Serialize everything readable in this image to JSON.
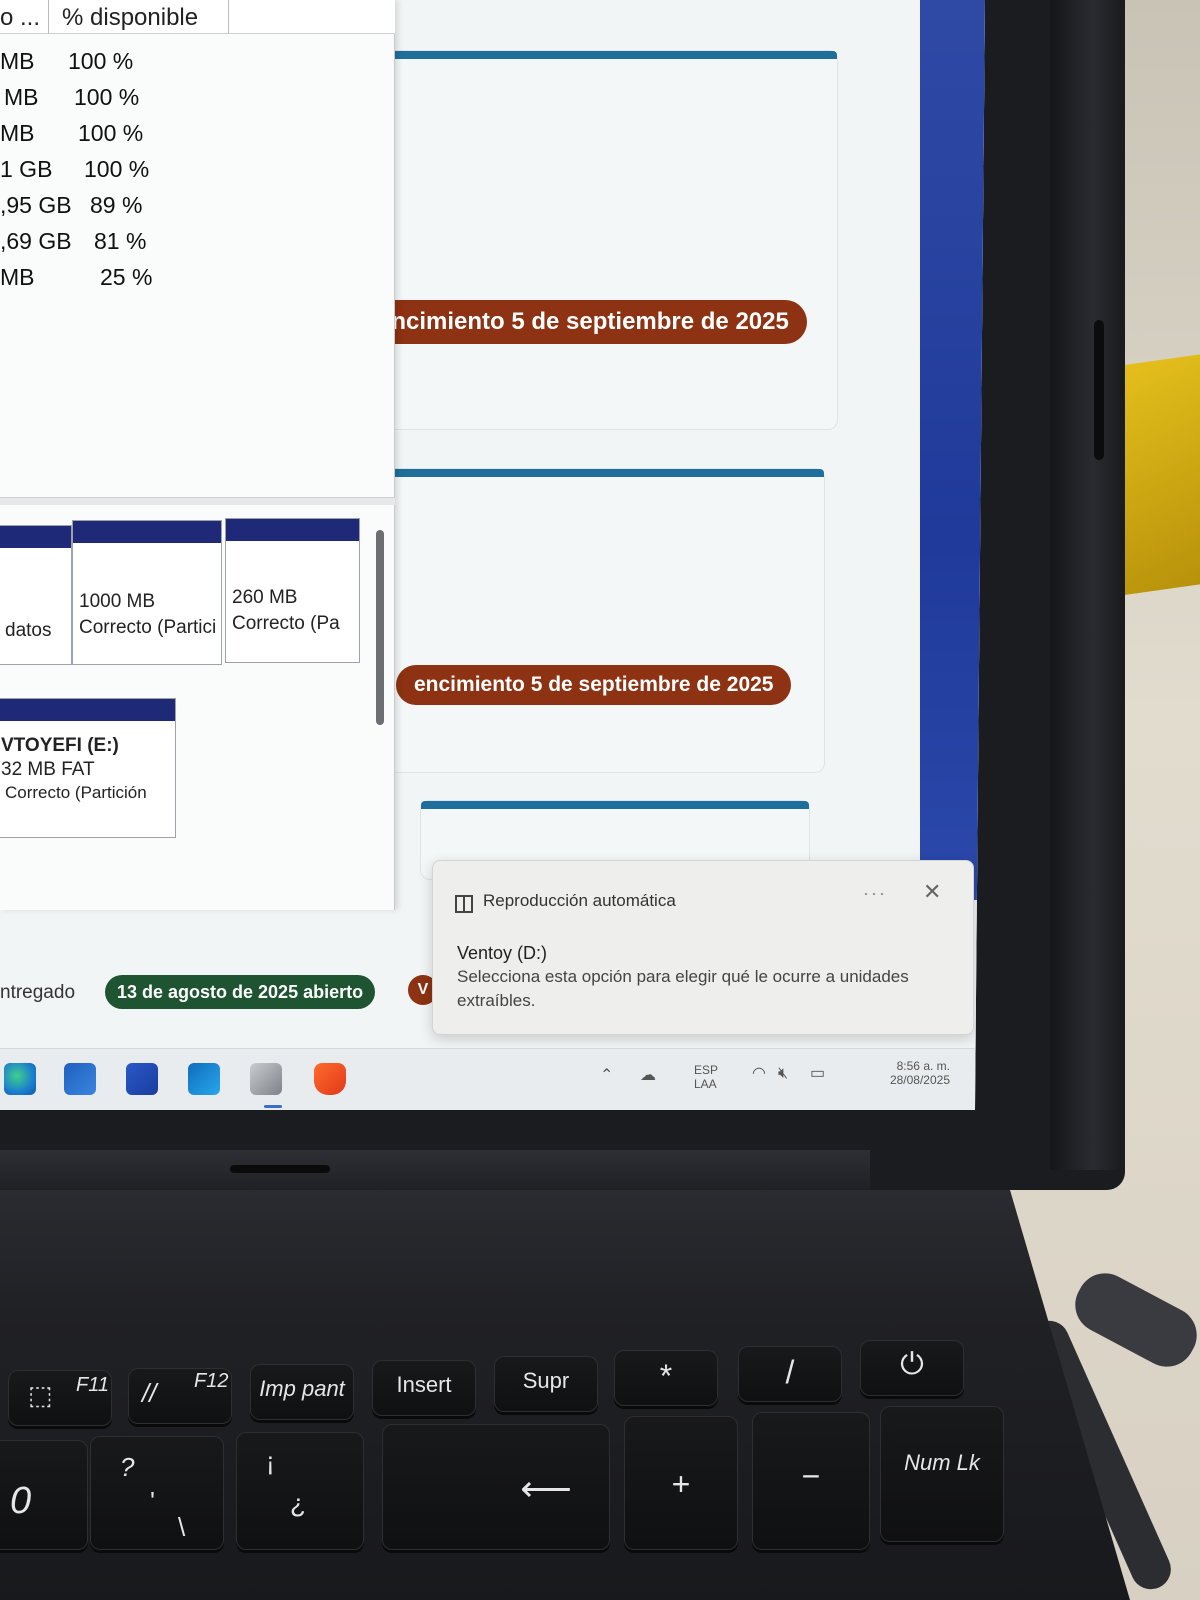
{
  "disk_manager": {
    "column_truncated": "o ...",
    "column_available": "% disponible",
    "volumes": [
      {
        "size": "MB",
        "available": "100 %"
      },
      {
        "size": "MB",
        "available": "100 %"
      },
      {
        "size": "MB",
        "available": "100 %"
      },
      {
        "size": "1 GB",
        "available": "100 %"
      },
      {
        "size": ",95 GB",
        "available": "89 %"
      },
      {
        "size": ",69 GB",
        "available": "81 %"
      },
      {
        "size": "MB",
        "available": "25 %"
      }
    ],
    "partitions": [
      {
        "line1": "",
        "line2": "datos"
      },
      {
        "line1": "1000 MB",
        "line2": "Correcto (Partici"
      },
      {
        "line1": "260 MB",
        "line2": "Correcto (Pa"
      }
    ],
    "ventoy_partition": {
      "name": "VTOYEFI  (E:)",
      "size": "32 MB FAT",
      "status": "Correcto (Partición"
    }
  },
  "web": {
    "due_label": "encimiento 5 de septiembre de 2025",
    "entregado": "ntregado",
    "open_badge": "13 de agosto de 2025 abierto",
    "red_badge_letter": "V"
  },
  "toast": {
    "header": "Reproducción automática",
    "dots": "···",
    "close": "✕",
    "title": "Ventoy (D:)",
    "body": "Selecciona esta opción para elegir qué le ocurre a unidades extraíbles."
  },
  "taskbar": {
    "language": "ESP",
    "layout": "LAA",
    "time": "8:56 a. m.",
    "date": "28/08/2025"
  },
  "keyboard": {
    "f11": "F11",
    "f12": "F12",
    "imp_pant": "Imp pant",
    "insert": "Insert",
    "supr": "Supr",
    "asterisk": "*",
    "slash": "/",
    "power": "⏻",
    "zero": "0",
    "question": "?",
    "apostrophe": "'",
    "backslash": "\\",
    "exclaim": "¡",
    "inv_question": "¿",
    "backspace": "⟵",
    "plus": "+",
    "minus": "−",
    "numlk": "Num Lk"
  },
  "colors": {
    "due_pill": "#8d3212",
    "open_pill": "#1f5432",
    "card_accent": "#1f6f9c",
    "partition_bar": "#1e2a78"
  }
}
